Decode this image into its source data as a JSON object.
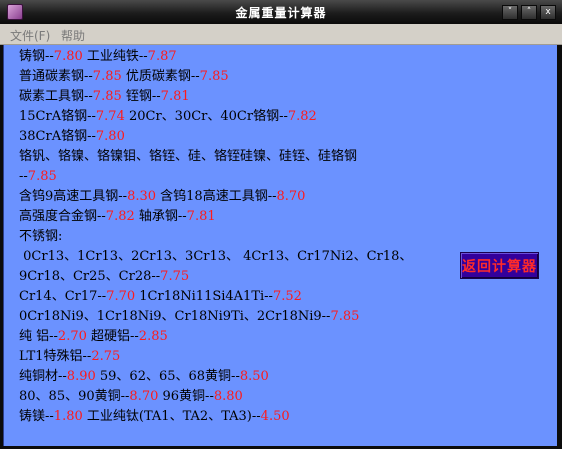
{
  "window": {
    "title": "金属重量计算器",
    "controls": [
      "˅",
      "˄",
      "x"
    ]
  },
  "menubar": {
    "file": "文件(F)",
    "help": "帮助"
  },
  "lines": [
    [
      {
        "t": "铸钢--"
      },
      {
        "t": "7.80",
        "r": true
      },
      {
        "t": " 工业纯铁--"
      },
      {
        "t": "7.87",
        "r": true
      }
    ],
    [
      {
        "t": "普通碳素钢--"
      },
      {
        "t": "7.85",
        "r": true
      },
      {
        "t": " 优质碳素钢--"
      },
      {
        "t": "7.85",
        "r": true
      }
    ],
    [
      {
        "t": "碳素工具钢--"
      },
      {
        "t": "7.85",
        "r": true
      },
      {
        "t": " 铚钢--"
      },
      {
        "t": "7.81",
        "r": true
      }
    ],
    [
      {
        "t": "15CrA铬钢--"
      },
      {
        "t": "7.74",
        "r": true
      },
      {
        "t": " 20Cr、30Cr、40Cr铬钢--"
      },
      {
        "t": "7.82",
        "r": true
      }
    ],
    [
      {
        "t": "38CrA铬钢--"
      },
      {
        "t": "7.80",
        "r": true
      }
    ],
    [
      {
        "t": "铬钒、铬镍、铬镍钼、铬铚、硅、铬铚硅镍、硅铚、硅铬钢"
      }
    ],
    [
      {
        "t": "--"
      },
      {
        "t": "7.85",
        "r": true
      }
    ],
    [
      {
        "t": "含钨9高速工具钢--"
      },
      {
        "t": "8.30",
        "r": true
      },
      {
        "t": " 含钨18高速工具钢--"
      },
      {
        "t": "8.70",
        "r": true
      }
    ],
    [
      {
        "t": "高强度合金钢--"
      },
      {
        "t": "7.82",
        "r": true
      },
      {
        "t": " 轴承钢--"
      },
      {
        "t": "7.81",
        "r": true
      }
    ],
    [
      {
        "t": "不锈钢:"
      }
    ],
    [
      {
        "t": " 0Cr13、1Cr13、2Cr13、3Cr13、 4Cr13、Cr17Ni2、Cr18、"
      }
    ],
    [
      {
        "t": "9Cr18、Cr25、Cr28--"
      },
      {
        "t": "7.75",
        "r": true
      }
    ],
    [
      {
        "t": "Cr14、Cr17--"
      },
      {
        "t": "7.70",
        "r": true
      },
      {
        "t": " 1Cr18Ni11Si4A1Ti--"
      },
      {
        "t": "7.52",
        "r": true
      }
    ],
    [
      {
        "t": "0Cr18Ni9、1Cr18Ni9、Cr18Ni9Ti、2Cr18Ni9--"
      },
      {
        "t": "7.85",
        "r": true
      }
    ],
    [
      {
        "t": "纯 铝--"
      },
      {
        "t": "2.70",
        "r": true
      },
      {
        "t": " 超硬铝--"
      },
      {
        "t": "2.85",
        "r": true
      }
    ],
    [
      {
        "t": "LT1特殊铝--"
      },
      {
        "t": "2.75",
        "r": true
      }
    ],
    [
      {
        "t": "纯铜材--"
      },
      {
        "t": "8.90",
        "r": true
      },
      {
        "t": " 59、62、65、68黄铜--"
      },
      {
        "t": "8.50",
        "r": true
      }
    ],
    [
      {
        "t": "80、85、90黄铜--"
      },
      {
        "t": "8.70",
        "r": true
      },
      {
        "t": " 96黄铜--"
      },
      {
        "t": "8.80",
        "r": true
      }
    ],
    [
      {
        "t": "铸镁--"
      },
      {
        "t": "1.80",
        "r": true
      },
      {
        "t": " 工业纯钛(TA1、TA2、TA3)--"
      },
      {
        "t": "4.50",
        "r": true
      }
    ]
  ],
  "return_button": {
    "label": "返回计算器"
  },
  "colors": {
    "content_bg": "#6b92ff",
    "value_red": "#ff1a1a",
    "button_bg": "#33009c"
  }
}
